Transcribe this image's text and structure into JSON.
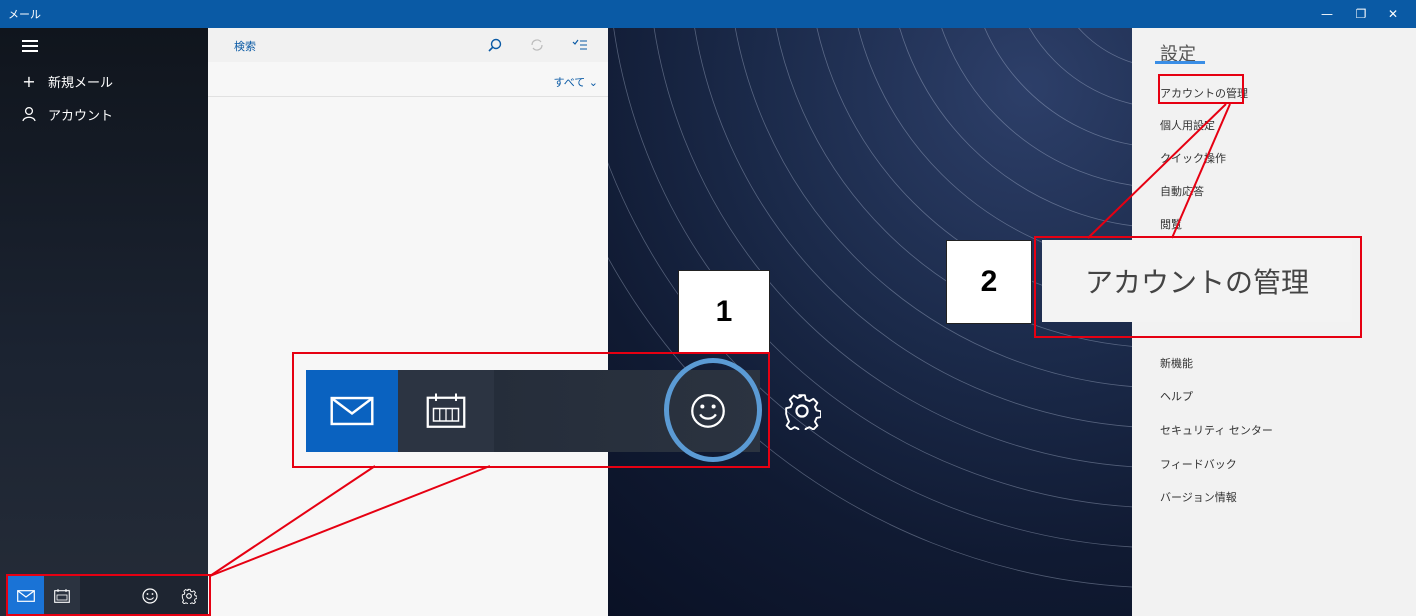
{
  "window": {
    "title": "メール"
  },
  "nav": {
    "new_mail_label": "新規メール",
    "account_label": "アカウント"
  },
  "list": {
    "search_label": "検索",
    "filter_label": "すべて"
  },
  "settings": {
    "title": "設定",
    "items": [
      "アカウントの管理",
      "個人用設定",
      "クイック操作",
      "自動応答",
      "閲覧",
      "新機能",
      "ヘルプ",
      "セキュリティ センター",
      "フィードバック",
      "バージョン情報"
    ]
  },
  "callouts": {
    "step1": "1",
    "step2": "2",
    "zoom_label": "アカウントの管理"
  },
  "colors": {
    "accent": "#0a5aa5",
    "highlight_red": "#e60012",
    "circle_blue": "#5b9bd5"
  },
  "icons": {
    "mail": "mail-icon",
    "calendar": "calendar-icon",
    "smile": "smile-icon",
    "gear": "gear-icon"
  }
}
